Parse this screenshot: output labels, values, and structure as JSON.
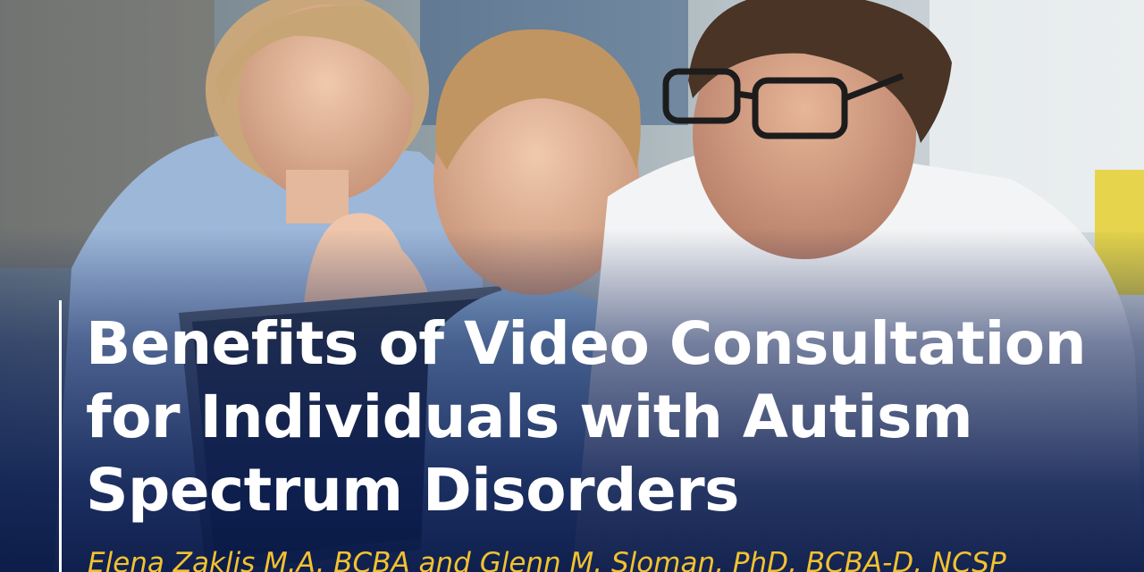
{
  "title": {
    "line1": "Benefits of Video Consultation",
    "line2": "for Individuals with Autism",
    "line3": "Spectrum Disorders"
  },
  "authors": "Elena Zaklis M.A. BCBA and Glenn M. Sloman, PhD, BCBA-D, NCSP",
  "colors": {
    "title": "#ffffff",
    "authors": "#f2c230",
    "overlay": "#0a1c50"
  }
}
